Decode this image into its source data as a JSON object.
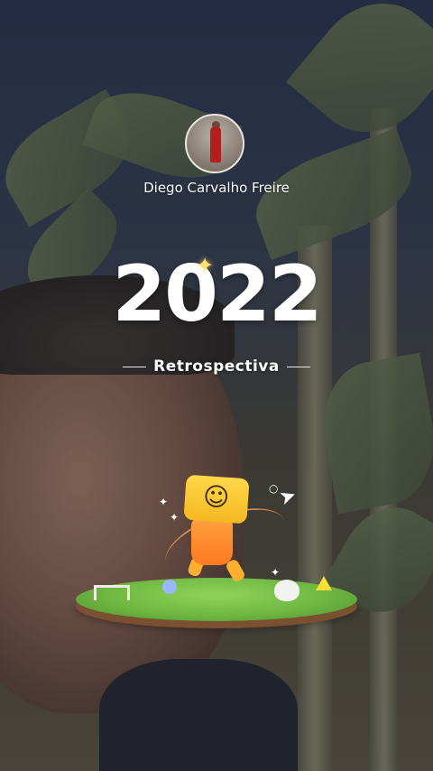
{
  "story": {
    "username": "Diego Carvalho Freire",
    "year": "2022",
    "subtitle": "Retrospectiva"
  },
  "icons": {
    "avatar": "profile-avatar",
    "sparkle": "sparkle-icon",
    "mascot": "smiley-mascot",
    "paper_plane": "paper-plane-icon"
  },
  "colors": {
    "title_text": "#ffffff",
    "sparkle": "#ffe070",
    "island_grass": "#6fb842",
    "mascot_head": "#ffd84a",
    "mascot_body": "#ff7a20"
  }
}
